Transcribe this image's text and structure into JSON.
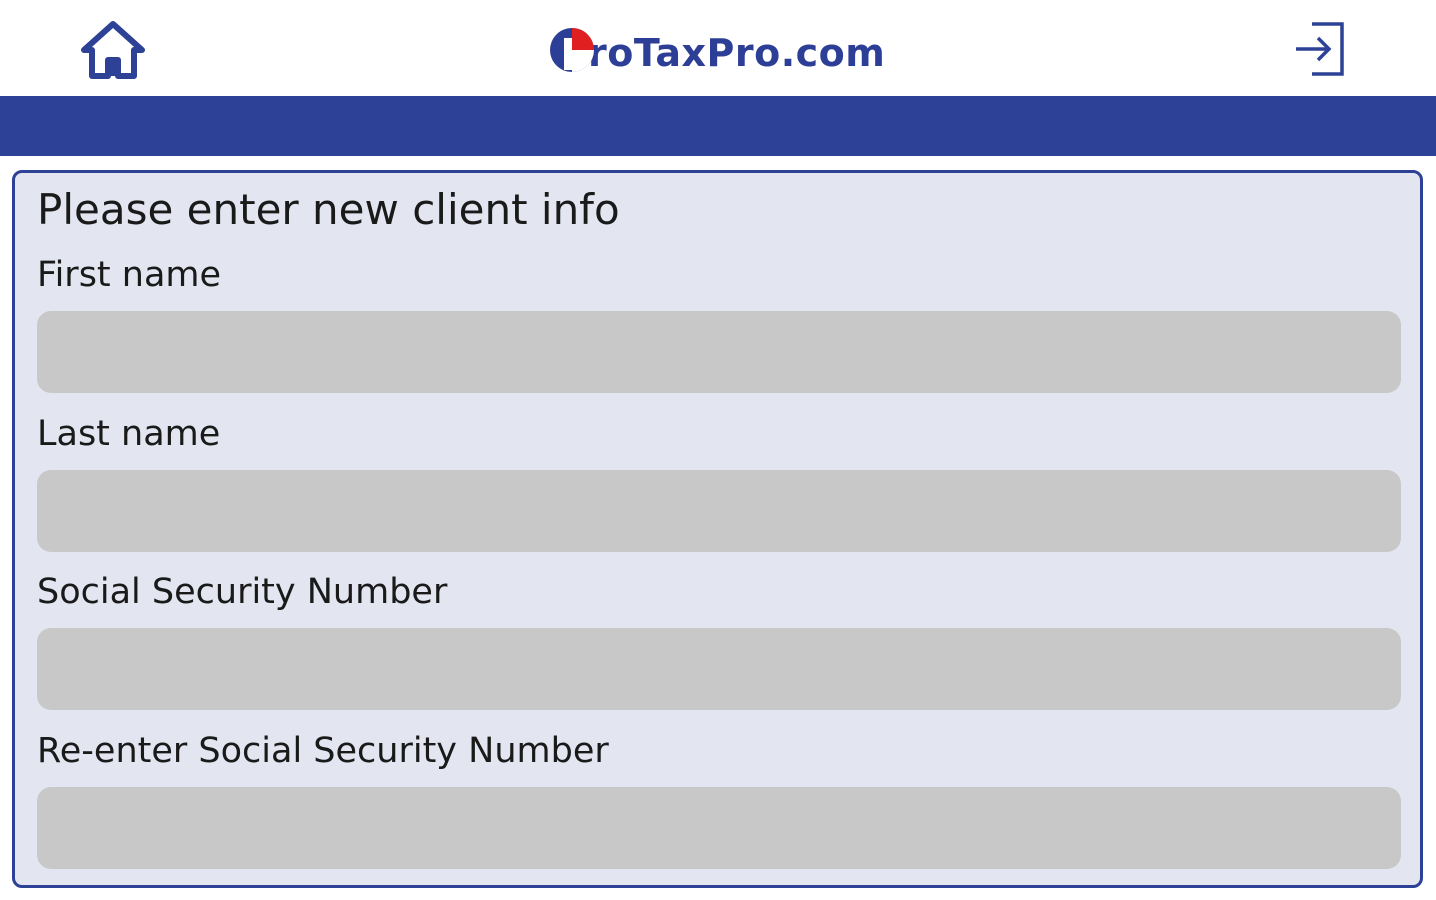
{
  "header": {
    "logo_text": "roTaxPro.com",
    "logo_full": "ProTaxPro.com",
    "home_icon": "home-icon",
    "logout_icon": "login-arrow-icon",
    "accent_color": "#2d4296"
  },
  "form": {
    "title": "Please enter new client info",
    "fields": [
      {
        "label": "First name",
        "value": ""
      },
      {
        "label": "Last name",
        "value": ""
      },
      {
        "label": "Social Security Number",
        "value": ""
      },
      {
        "label": "Re-enter Social Security Number",
        "value": ""
      }
    ]
  }
}
